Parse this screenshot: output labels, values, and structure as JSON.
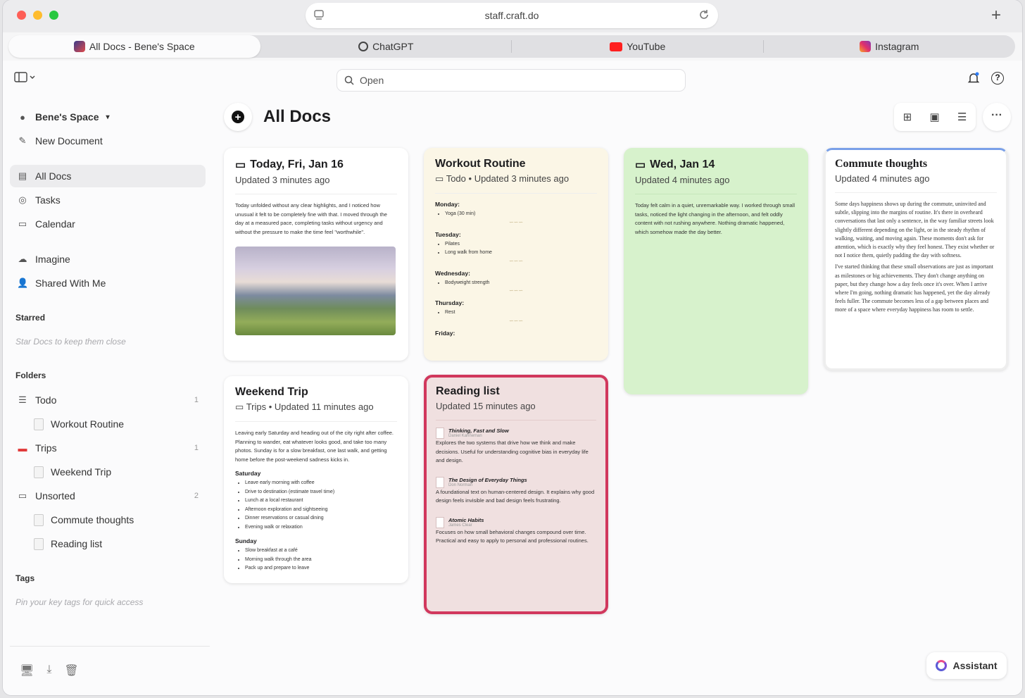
{
  "browser": {
    "url": "staff.craft.do",
    "tabs": [
      {
        "label": "All Docs - Bene's Space",
        "icon": "craft-icon",
        "active": true
      },
      {
        "label": "ChatGPT",
        "icon": "chatgpt-icon"
      },
      {
        "label": "YouTube",
        "icon": "youtube-icon"
      },
      {
        "label": "Instagram",
        "icon": "instagram-icon"
      }
    ]
  },
  "search": {
    "placeholder": "Open"
  },
  "sidebar": {
    "space": "Bene's Space",
    "new_document": "New Document",
    "nav": [
      {
        "label": "All Docs",
        "icon": "all-docs-icon",
        "active": true
      },
      {
        "label": "Tasks",
        "icon": "tasks-icon"
      },
      {
        "label": "Calendar",
        "icon": "calendar-icon"
      },
      {
        "label": "Imagine",
        "icon": "cloud-icon"
      },
      {
        "label": "Shared With Me",
        "icon": "shared-icon"
      }
    ],
    "starred_title": "Starred",
    "starred_hint": "Star Docs to keep them close",
    "folders_title": "Folders",
    "folders": [
      {
        "label": "Todo",
        "count": "1",
        "children": [
          "Workout Routine"
        ]
      },
      {
        "label": "Trips",
        "count": "1",
        "children": [
          "Weekend Trip"
        ]
      },
      {
        "label": "Unsorted",
        "count": "2",
        "children": [
          "Commute thoughts",
          "Reading list"
        ]
      }
    ],
    "tags_title": "Tags",
    "tags_hint": "Pin your key tags for quick access"
  },
  "main": {
    "title": "All Docs"
  },
  "cards": {
    "today": {
      "title": "Today, Fri, Jan 16",
      "meta": "Updated 3 minutes ago",
      "body": "Today unfolded without any clear highlights, and I noticed how unusual it felt to be completely fine with that. I moved through the day at a measured pace, completing tasks without urgency and without the pressure to make the time feel \"worthwhile\"."
    },
    "workout": {
      "title": "Workout Routine",
      "folder": "Todo",
      "meta": "Updated 3 minutes ago",
      "days": [
        {
          "day": "Monday:",
          "items": [
            "Yoga (30 min)"
          ]
        },
        {
          "day": "Tuesday:",
          "items": [
            "Pilates",
            "Long walk from home"
          ]
        },
        {
          "day": "Wednesday:",
          "items": [
            "Bodyweight strength"
          ]
        },
        {
          "day": "Thursday:",
          "items": [
            "Rest"
          ]
        },
        {
          "day": "Friday:",
          "items": []
        }
      ]
    },
    "wed": {
      "title": "Wed, Jan 14",
      "meta": "Updated 4 minutes ago",
      "body": "Today felt calm in a quiet, unremarkable way. I worked through small tasks, noticed the light changing in the afternoon, and felt oddly content with not rushing anywhere. Nothing dramatic happened, which somehow made the day better."
    },
    "commute": {
      "title": "Commute thoughts",
      "meta": "Updated 4 minutes ago",
      "p1": "Some days happiness shows up during the commute, uninvited and subtle, slipping into the margins of routine. It's there in overheard conversations that last only a sentence, in the way familiar streets look slightly different depending on the light, or in the steady rhythm of walking, waiting, and moving again. These moments don't ask for attention, which is exactly why they feel honest. They exist whether or not I notice them, quietly padding the day with softness.",
      "p2": "I've started thinking that these small observations are just as important as milestones or big achievements. They don't change anything on paper, but they change how a day feels once it's over. When I arrive where I'm going, nothing dramatic has happened, yet the day already feels fuller. The commute becomes less of a gap between places and more of a space where everyday happiness has room to settle."
    },
    "weekend": {
      "title": "Weekend Trip",
      "folder": "Trips",
      "meta": "Updated 11 minutes ago",
      "body": "Leaving early Saturday and heading out of the city right after coffee. Planning to wander, eat whatever looks good, and take too many photos. Sunday is for a slow breakfast, one last walk, and getting home before the post-weekend sadness kicks in.",
      "sat_title": "Saturday",
      "sat": [
        "Leave early morning with coffee",
        "Drive to destination (estimate travel time)",
        "Lunch at a local restaurant",
        "Afternoon exploration and sightseeing",
        "Dinner reservations or casual dining",
        "Evening walk or relaxation"
      ],
      "sun_title": "Sunday",
      "sun": [
        "Slow breakfast at a café",
        "Morning walk through the area",
        "Pack up and prepare to leave"
      ]
    },
    "reading": {
      "title": "Reading list",
      "meta": "Updated 15 minutes ago",
      "books": [
        {
          "title": "Thinking, Fast and Slow",
          "author": "Daniel Kahneman",
          "desc": "Explores the two systems that drive how we think and make decisions. Useful for understanding cognitive bias in everyday life and design."
        },
        {
          "title": "The Design of Everyday Things",
          "author": "Don Norman",
          "desc": "A foundational text on human-centered design. It explains why good design feels invisible and bad design feels frustrating."
        },
        {
          "title": "Atomic Habits",
          "author": "James Clear",
          "desc": "Focuses on how small behavioral changes compound over time. Practical and easy to apply to personal and professional routines."
        }
      ]
    }
  },
  "assistant": {
    "label": "Assistant"
  },
  "colors": {
    "workout_bg": "#fbf6e6",
    "wed_bg": "#d7f2cc",
    "reading_bg": "#f0e0e0",
    "reading_border": "#d1385d",
    "commute_border": "#7aa0e8"
  }
}
